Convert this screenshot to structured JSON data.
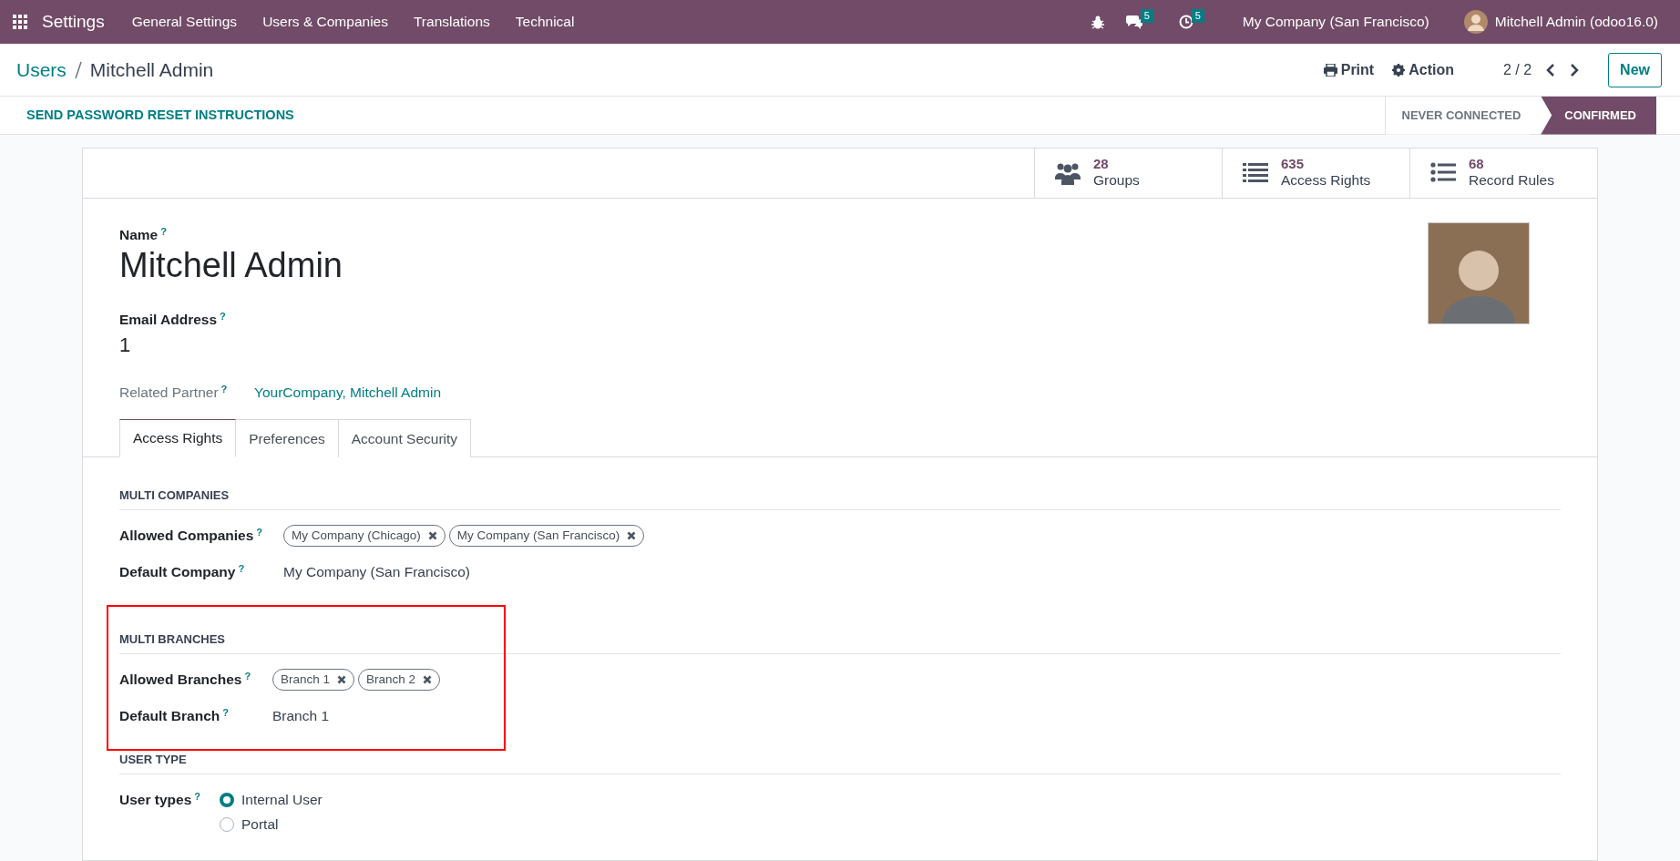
{
  "navbar": {
    "app": "Settings",
    "menu": [
      "General Settings",
      "Users & Companies",
      "Translations",
      "Technical"
    ],
    "messages_badge": "5",
    "activities_badge": "5",
    "company": "My Company (San Francisco)",
    "user": "Mitchell Admin (odoo16.0)"
  },
  "breadcrumb": {
    "parent": "Users",
    "current": "Mitchell Admin"
  },
  "actions": {
    "print": "Print",
    "action": "Action",
    "pager": "2 / 2",
    "new": "New"
  },
  "statusbar": {
    "button": "SEND PASSWORD RESET INSTRUCTIONS",
    "steps": [
      {
        "label": "NEVER CONNECTED",
        "selected": false
      },
      {
        "label": "CONFIRMED",
        "selected": true
      }
    ]
  },
  "stat_buttons": [
    {
      "kind": "groups",
      "value": "28",
      "label": "Groups"
    },
    {
      "kind": "list",
      "value": "635",
      "label": "Access Rights"
    },
    {
      "kind": "bullets",
      "value": "68",
      "label": "Record Rules"
    }
  ],
  "name_label": "Name",
  "name_help": "?",
  "name": "Mitchell Admin",
  "email_label": "Email Address",
  "email_help": "?",
  "email": "1",
  "partner_label": "Related Partner",
  "partner_help": "?",
  "partner": "YourCompany, Mitchell Admin",
  "tabs": [
    {
      "label": "Access Rights",
      "selected": true
    },
    {
      "label": "Preferences",
      "selected": false
    },
    {
      "label": "Account Security",
      "selected": false
    }
  ],
  "sections": [
    {
      "title": "MULTI COMPANIES",
      "highlighted": false,
      "fields": [
        {
          "kind": "tags",
          "label": "Allowed Companies",
          "help": "?",
          "tags": [
            "My Company (Chicago)",
            "My Company (San Francisco)"
          ]
        },
        {
          "kind": "text",
          "label": "Default Company",
          "help": "?",
          "value": "My Company (San Francisco)"
        }
      ]
    },
    {
      "title": "MULTI BRANCHES",
      "highlighted": true,
      "fields": [
        {
          "kind": "tags",
          "label": "Allowed Branches",
          "help": "?",
          "tags": [
            "Branch 1",
            "Branch 2"
          ]
        },
        {
          "kind": "text",
          "label": "Default Branch",
          "help": "?",
          "value": "Branch 1"
        }
      ]
    },
    {
      "title": "USER TYPE",
      "highlighted": false,
      "fields": [
        {
          "kind": "radio",
          "label": "User types",
          "help": "?",
          "options": [
            {
              "label": "Internal User",
              "selected": true
            },
            {
              "label": "Portal",
              "selected": false
            }
          ]
        }
      ]
    }
  ]
}
